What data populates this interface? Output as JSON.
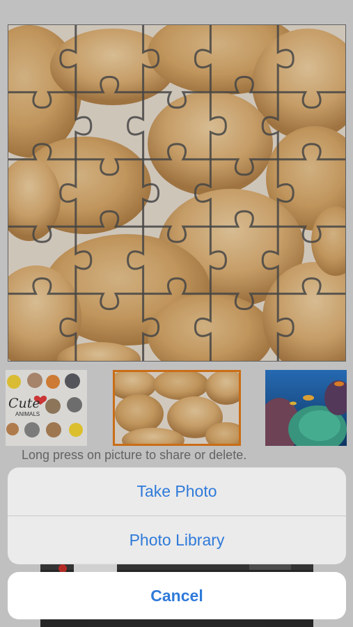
{
  "puzzle": {
    "image": "fortune-cookies",
    "grid_columns": 5,
    "grid_rows": 5
  },
  "thumbnails": [
    {
      "name": "cute-animals",
      "selected": false,
      "logo_text": "Cute",
      "logo_subtext": "ANIMALS"
    },
    {
      "name": "fortune-cookies",
      "selected": true
    },
    {
      "name": "coral-reef",
      "selected": false
    }
  ],
  "hint": "Long press on picture to share or delete.",
  "action_sheet": {
    "options": [
      "Take Photo",
      "Photo Library"
    ],
    "cancel": "Cancel",
    "accent_color": "#2f7ad9"
  }
}
